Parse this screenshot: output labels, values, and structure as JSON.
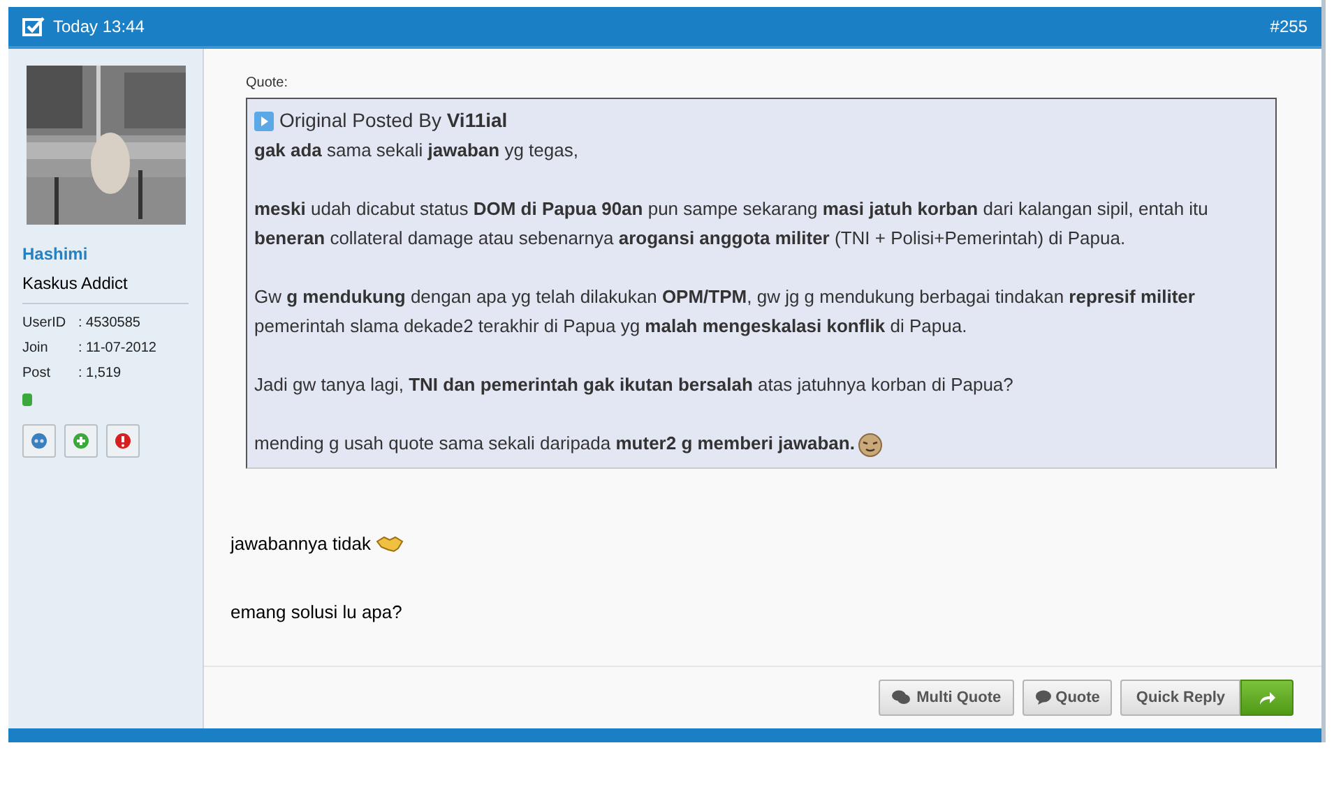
{
  "post_header": {
    "time": "Today 13:44",
    "number": "#255"
  },
  "user": {
    "name": "Hashimi",
    "rank": "Kaskus Addict",
    "online": true,
    "stats": [
      {
        "label": "UserID",
        "value": ": 4530585"
      },
      {
        "label": "Join",
        "value": ": 11-07-2012"
      },
      {
        "label": "Post",
        "value": ": 1,519"
      }
    ]
  },
  "quote": {
    "label": "Quote:",
    "posted_by_prefix": "Original Posted By",
    "author": "Vi11ial",
    "paragraphs": [
      "**gak ada** sama sekali **jawaban** yg tegas,",
      "**meski** udah dicabut status **DOM di Papua 90an** pun sampe sekarang **masi jatuh korban** dari kalangan sipil, entah itu **beneran** collateral damage atau sebenarnya **arogansi anggota militer** (TNI + Polisi+Pemerintah) di Papua.",
      "Gw **g mendukung** dengan apa yg telah dilakukan **OPM/TPM**, gw jg g mendukung berbagai tindakan **represif militer** pemerintah slama dekade2 terakhir di Papua yg **malah mengeskalasi konflik** di Papua.",
      "Jadi gw tanya lagi, **TNI dan pemerintah gak ikutan bersalah** atas jatuhnya korban di Papua?",
      "mending g usah quote sama sekali daripada **muter2 g memberi jawaban.**"
    ]
  },
  "reply": [
    "jawabannya tidak",
    "emang solusi lu apa?"
  ],
  "buttons": {
    "multi_quote": "Multi Quote",
    "quote": "Quote",
    "quick_reply": "Quick Reply"
  }
}
